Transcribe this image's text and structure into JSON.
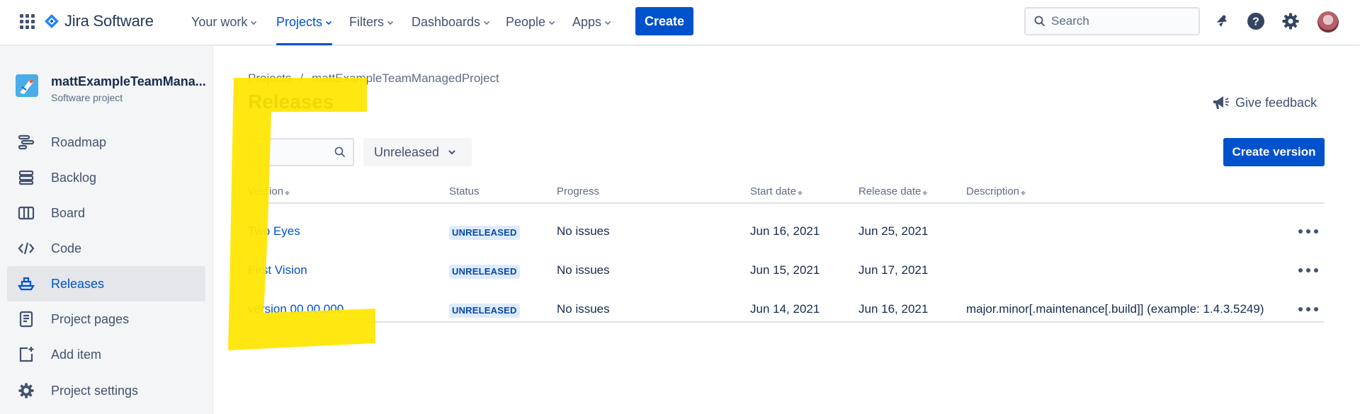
{
  "topnav": {
    "brand": "Jira Software",
    "items": [
      {
        "label": "Your work"
      },
      {
        "label": "Projects"
      },
      {
        "label": "Filters"
      },
      {
        "label": "Dashboards"
      },
      {
        "label": "People"
      },
      {
        "label": "Apps"
      }
    ],
    "active_item": "Projects",
    "create_label": "Create",
    "search_placeholder": "Search",
    "accent": "#0052cc"
  },
  "sidebar": {
    "project_name": "mattExampleTeamMana...",
    "project_type": "Software project",
    "items": [
      {
        "label": "Roadmap",
        "icon": "roadmap-icon"
      },
      {
        "label": "Backlog",
        "icon": "backlog-icon"
      },
      {
        "label": "Board",
        "icon": "board-icon"
      },
      {
        "label": "Code",
        "icon": "code-icon"
      },
      {
        "label": "Releases",
        "icon": "ship-icon"
      },
      {
        "label": "Project pages",
        "icon": "pages-icon"
      },
      {
        "label": "Add item",
        "icon": "add-item-icon"
      },
      {
        "label": "Project settings",
        "icon": "gear-icon"
      }
    ],
    "active_item": "Releases"
  },
  "main": {
    "breadcrumb": [
      "Projects",
      "mattExampleTeamManagedProject"
    ],
    "breadcrumb_separator": "/",
    "title": "Releases",
    "feedback_label": "Give feedback",
    "filter_placeholder": "",
    "status_filter": "Unreleased",
    "create_version_label": "Create version",
    "columns": [
      "Version",
      "Status",
      "Progress",
      "Start date",
      "Release date",
      "Description"
    ],
    "rows": [
      {
        "version": "Two Eyes",
        "status": "UNRELEASED",
        "progress": "No issues",
        "start": "Jun 16, 2021",
        "release": "Jun 25, 2021",
        "description": ""
      },
      {
        "version": "First Vision",
        "status": "UNRELEASED",
        "progress": "No issues",
        "start": "Jun 15, 2021",
        "release": "Jun 17, 2021",
        "description": ""
      },
      {
        "version": "version 00.00.000",
        "status": "UNRELEASED",
        "progress": "No issues",
        "start": "Jun 14, 2021",
        "release": "Jun 16, 2021",
        "description": "major.minor[.maintenance[.build]] (example: 1.4.3.5249)"
      }
    ],
    "lozenge_color": "#deebff",
    "highlight_color": "#ffe500"
  }
}
